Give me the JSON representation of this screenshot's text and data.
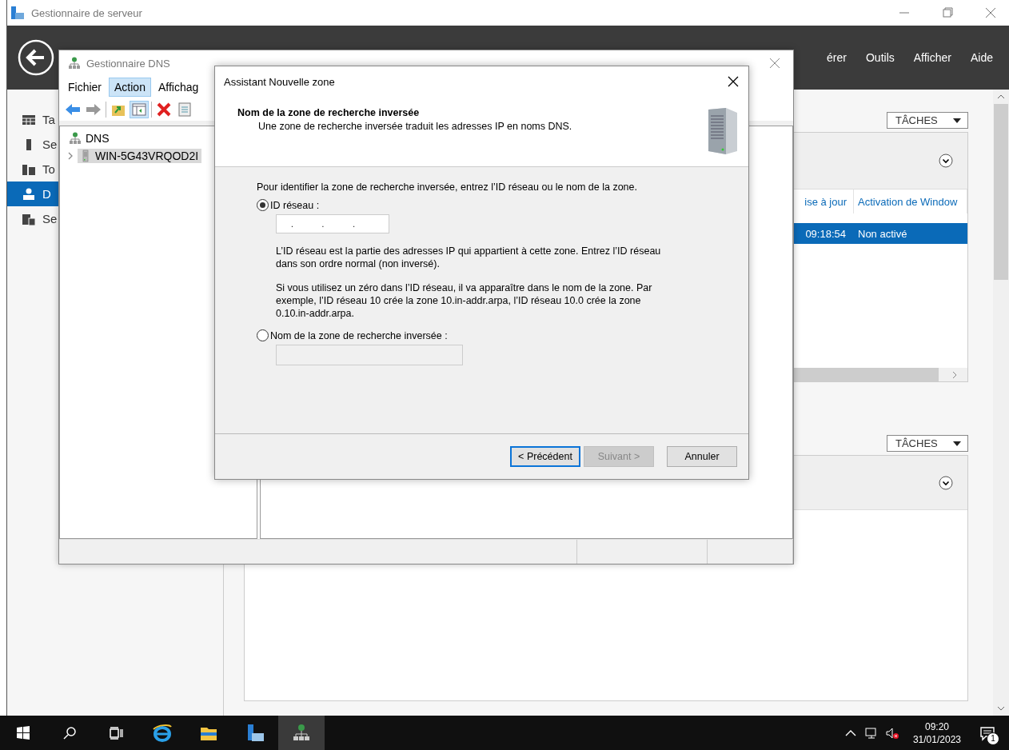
{
  "server_manager": {
    "title": "Gestionnaire de serveur",
    "menu": [
      {
        "label": "érer"
      },
      {
        "label": "Outils"
      },
      {
        "label": "Afficher"
      },
      {
        "label": "Aide"
      }
    ],
    "sidebar": {
      "items": [
        {
          "label": "Ta",
          "kind": "dashboard",
          "selected": false
        },
        {
          "label": "Se",
          "kind": "server",
          "selected": false
        },
        {
          "label": "To",
          "kind": "servers",
          "selected": false
        },
        {
          "label": "D",
          "kind": "dns",
          "selected": true
        },
        {
          "label": "Se",
          "kind": "files",
          "selected": false
        }
      ]
    },
    "tiles": [
      {
        "tasks_label": "TÂCHES",
        "columns": [
          "ise à jour",
          "Activation de Window"
        ],
        "rows": [
          {
            "cells": [
              "09:18:54",
              "Non activé"
            ],
            "selected": true
          }
        ]
      },
      {
        "tasks_label": "TÂCHES"
      }
    ]
  },
  "dns_manager": {
    "title": "Gestionnaire DNS",
    "menu": [
      {
        "label": "Fichier",
        "selected": false
      },
      {
        "label": "Action",
        "selected": true
      },
      {
        "label": "Affichag",
        "selected": false
      }
    ],
    "tree": [
      {
        "label": "DNS",
        "kind": "root",
        "children": [
          {
            "label": "WIN-5G43VRQOD2I",
            "kind": "server",
            "selected": true,
            "expanded": false
          }
        ]
      }
    ]
  },
  "wizard": {
    "title": "Assistant Nouvelle zone",
    "heading": "Nom de la zone de recherche inversée",
    "subheading": "Une zone de recherche inversée traduit les adresses IP en noms DNS.",
    "instruction": "Pour identifier la zone de recherche inversée, entrez l’ID réseau ou le nom de la zone.",
    "options": [
      {
        "label": "ID réseau :",
        "kind": "ip",
        "selected": true,
        "separators": [
          ".",
          ".",
          "."
        ],
        "help": [
          "L’ID réseau est la partie des adresses IP qui appartient à cette zone. Entrez l’ID réseau dans son ordre normal (non inversé).",
          "Si vous utilisez un zéro dans l’ID réseau, il va apparaître dans le nom de la zone. Par exemple, l’ID réseau 10 crée la zone 10.in-addr.arpa, l’ID réseau 10.0 crée la zone 0.10.in-addr.arpa."
        ]
      },
      {
        "label": "Nom de la zone de recherche inversée :",
        "kind": "text",
        "selected": false
      }
    ],
    "buttons": [
      {
        "label": "< Précédent",
        "default": true,
        "disabled": false
      },
      {
        "label": "Suivant >",
        "default": false,
        "disabled": true
      },
      {
        "label": "Annuler",
        "default": false,
        "disabled": false
      }
    ]
  },
  "taskbar": {
    "apps": [
      {
        "kind": "ie",
        "active": false
      },
      {
        "kind": "explorer",
        "active": false
      },
      {
        "kind": "servermanager",
        "active": false
      },
      {
        "kind": "dns",
        "active": true
      }
    ],
    "time": "09:20",
    "date": "31/01/2023",
    "notification_count": "1"
  }
}
